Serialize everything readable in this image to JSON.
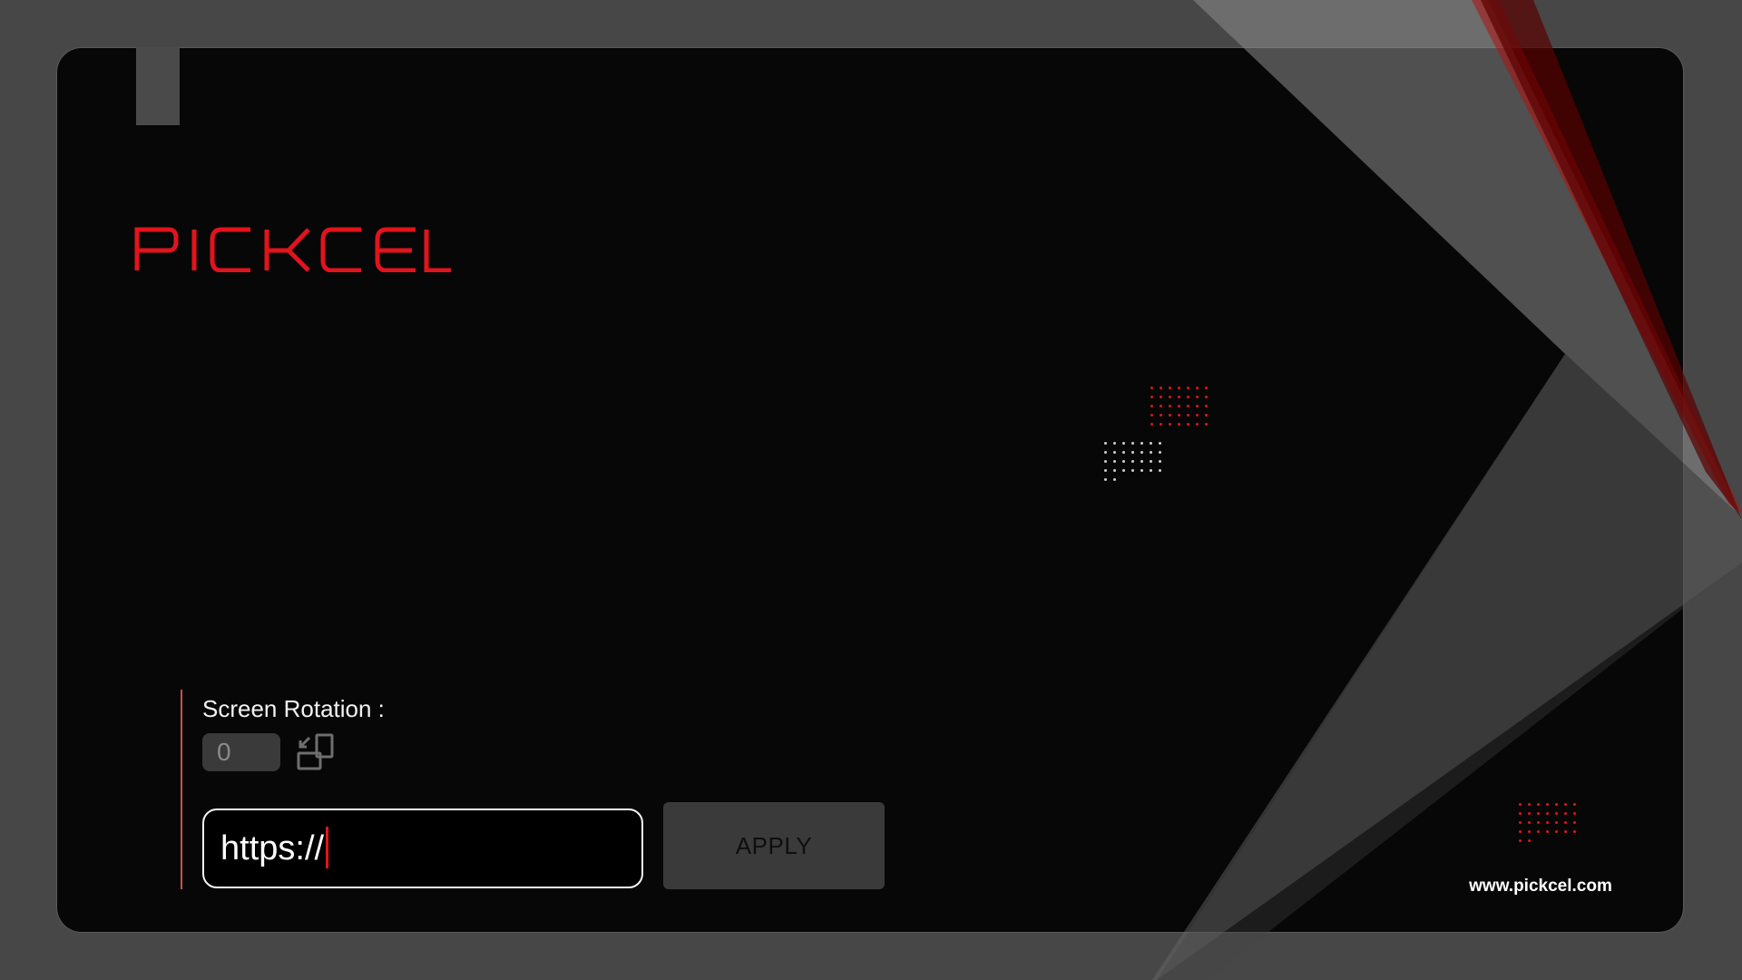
{
  "brand": {
    "name": "PICKCEL",
    "color": "#e3131b",
    "website": "www.pickcel.com"
  },
  "settings": {
    "rotation_label": "Screen Rotation :",
    "rotation_value": "0",
    "rotation_icon": "rotate-screen-icon",
    "url_value": "https://",
    "apply_label": "APPLY"
  },
  "colors": {
    "background": "#474747",
    "card": "#070707",
    "accent": "#e3131b",
    "button": "#3a3a3a"
  }
}
